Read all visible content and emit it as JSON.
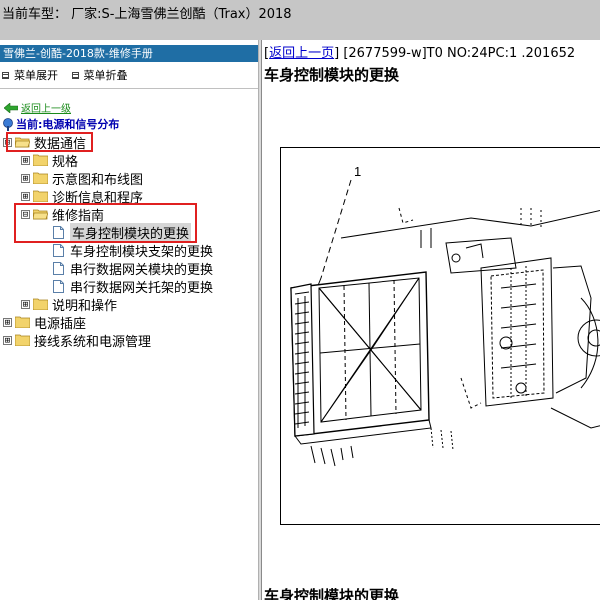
{
  "window": {
    "title": "当前车型：  厂家:S-上海雪佛兰创酷（Trax）2018"
  },
  "left_panel": {
    "header": "雪佛兰-创酷-2018款-维修手册",
    "menu_expand": "菜单展开",
    "menu_collapse": "菜单折叠",
    "back_link": "返回上一级",
    "current_label": "当前:电源和信号分布",
    "tree": [
      {
        "label": "数据通信",
        "expander": "⊟"
      },
      {
        "label": "规格",
        "expander": "⊞"
      },
      {
        "label": "示意图和布线图",
        "expander": "⊞"
      },
      {
        "label": "诊断信息和程序",
        "expander": "⊞"
      },
      {
        "label": "维修指南",
        "expander": "⊟"
      },
      {
        "label": "车身控制模块的更换"
      },
      {
        "label": "车身控制模块支架的更换"
      },
      {
        "label": "串行数据网关模块的更换"
      },
      {
        "label": "串行数据网关托架的更换"
      },
      {
        "label": "说明和操作",
        "expander": "⊞"
      },
      {
        "label": "电源插座",
        "expander": "⊞"
      },
      {
        "label": "接线系统和电源管理",
        "expander": "⊞"
      }
    ]
  },
  "content": {
    "back_link": "返回上一页",
    "doc_meta": "[2677599-w]T0 NO:24PC:1 .201652",
    "title": "车身控制模块的更换",
    "figure_callout": "1",
    "footer_title": "车身控制模块的更换"
  },
  "colors": {
    "header_bg": "#1f6ea5",
    "highlight_box": "#e02020",
    "link": "#0000cc",
    "back_link_green": "#1a8b1a",
    "current_label": "#0000b0"
  }
}
